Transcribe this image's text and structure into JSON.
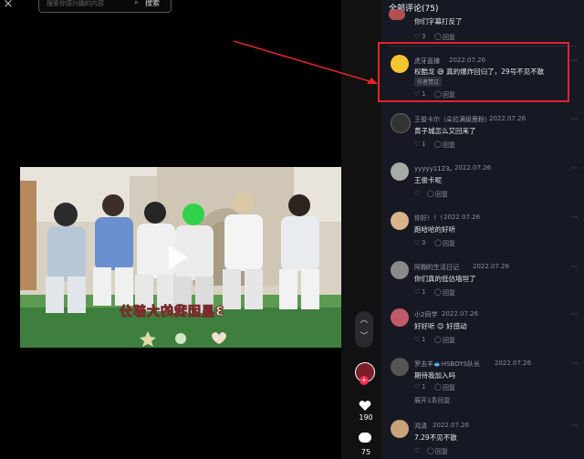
{
  "search": {
    "placeholder": "搜索你感兴趣的内容",
    "button": "搜索"
  },
  "video": {
    "caption": "3星团我的大部分"
  },
  "actions": {
    "likes": "190",
    "comments": "75"
  },
  "comments_panel": {
    "title": "全部评论(75)"
  },
  "comments": [
    {
      "user": "",
      "date": "",
      "text": "你们字幕打反了",
      "likes": "3",
      "reply": "回复",
      "avatar_color": "#b05050"
    },
    {
      "user": "虎牙直播",
      "date": "2022.07.26",
      "text": "权酷龙 😅 真的爆炸回归了，29号不见不散",
      "badge": "作者赞过",
      "likes": "1",
      "reply": "回复",
      "avatar_color": "#f4c430"
    },
    {
      "user": "王俊卡尔（朵拉满级鹿粉）",
      "date": "2022.07.26",
      "text": "黄子城怎么又回来了",
      "likes": "1",
      "reply": "回复",
      "avatar_color": "#333"
    },
    {
      "user": "yyyyy1123。",
      "date": "2022.07.26",
      "text": "王俊卡呢",
      "likes": "",
      "reply": "回复",
      "avatar_color": "#aaa"
    },
    {
      "user": "你好！！！",
      "date": "2022.07.26",
      "text": "跑哈哈的好听",
      "likes": "3",
      "reply": "回复",
      "avatar_color": "#d9b38c"
    },
    {
      "user": "阿糊的生活日记",
      "date": "2022.07.26",
      "text": "你们真的低估墙坦了",
      "likes": "1",
      "reply": "回复",
      "avatar_color": "#8a8a8a"
    },
    {
      "user": "小2同学",
      "date": "2022.07.26",
      "text": "好好听 😊 好感动",
      "likes": "1",
      "reply": "回复",
      "avatar_color": "#c05a6a"
    },
    {
      "user": "罗志羊🐟HSBOYS队长",
      "date": "2022.07.26",
      "text": "期待我加入吗",
      "likes": "1",
      "reply": "回复",
      "expand": "展开1条回复",
      "avatar_color": "#555"
    },
    {
      "user": "鸿清",
      "date": "2022.07.26",
      "text": "7.29不见不散",
      "likes": "",
      "reply": "回复",
      "avatar_color": "#c8a27a"
    }
  ],
  "colors": {
    "highlight_box": "#e0242a",
    "arrow": "#e0242a",
    "panel_bg": "#161823",
    "heart": "#ffffff"
  }
}
